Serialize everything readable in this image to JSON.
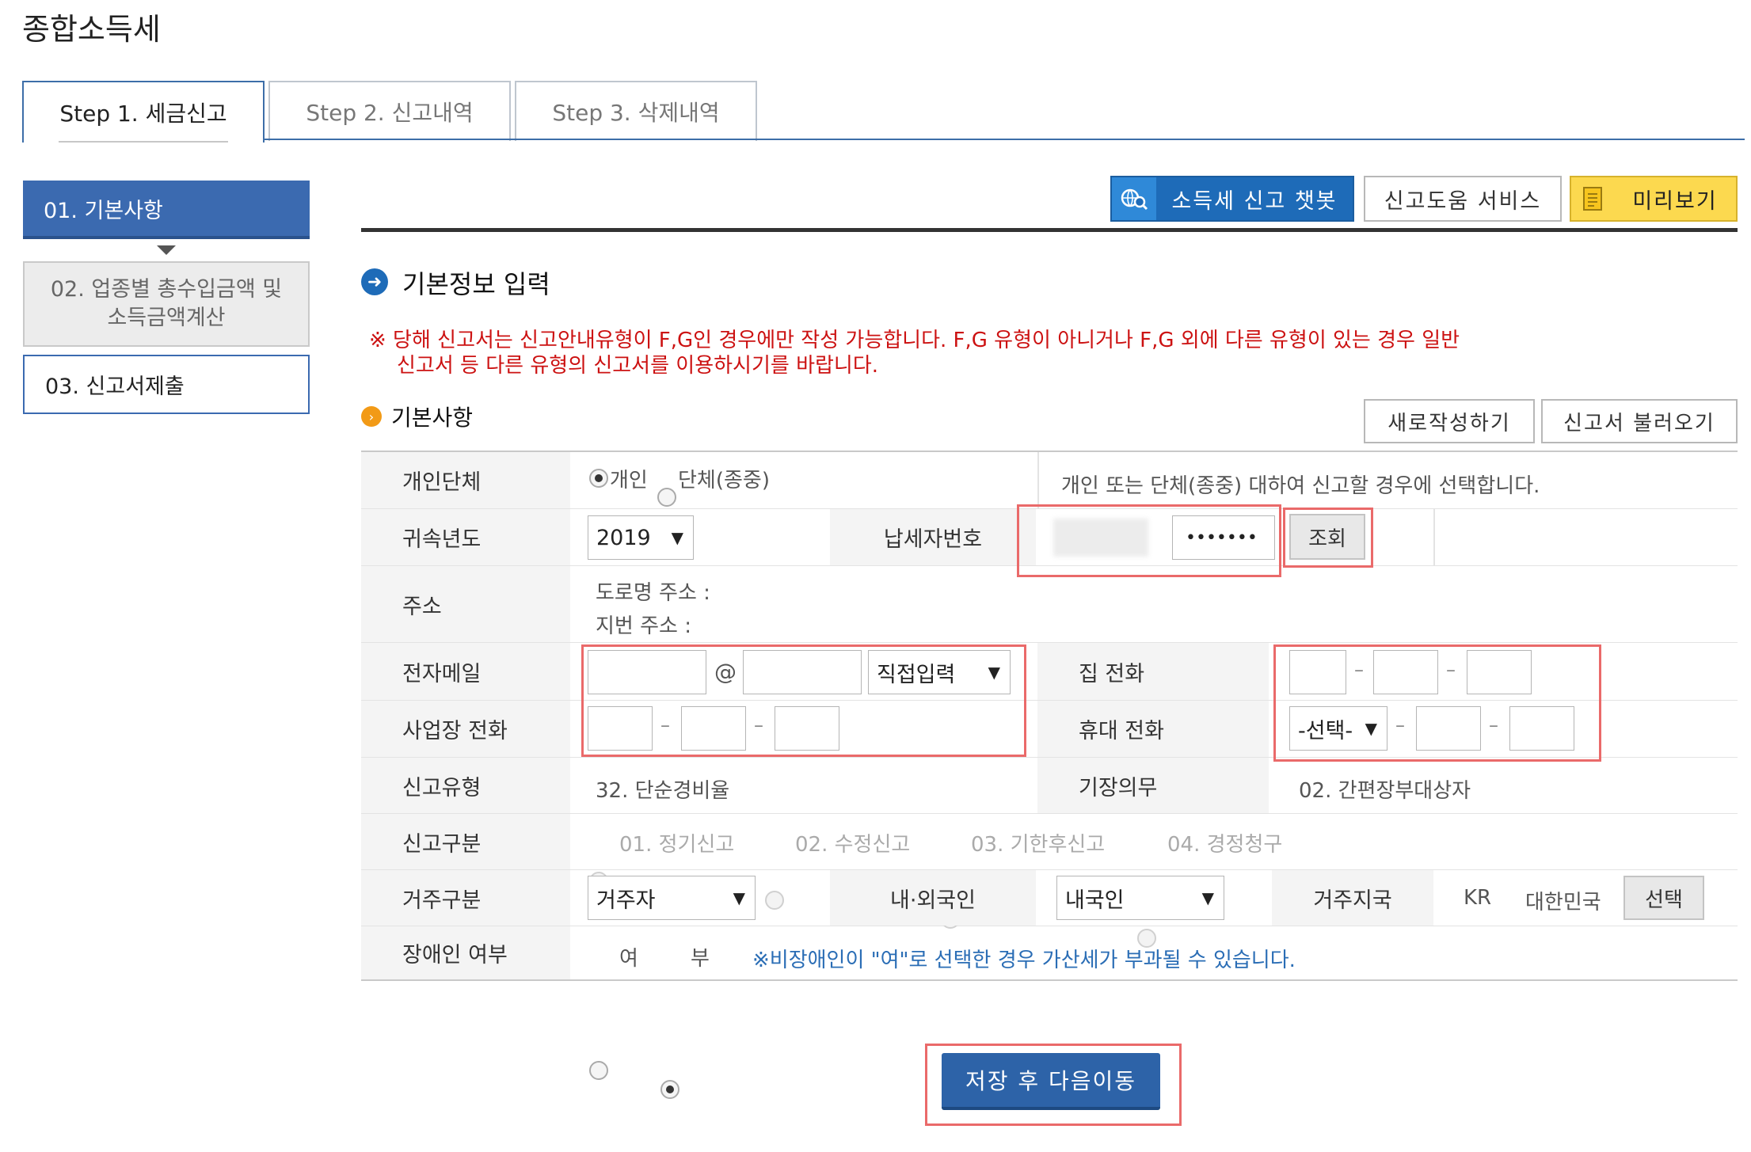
{
  "page_title": "종합소득세",
  "tabs": [
    {
      "label": "Step 1. 세금신고"
    },
    {
      "label": "Step 2. 신고내역"
    },
    {
      "label": "Step 3. 삭제내역"
    }
  ],
  "steps": [
    {
      "label": "01. 기본사항"
    },
    {
      "label_line1": "02. 업종별 총수입금액 및",
      "label_line2": "소득금액계산"
    },
    {
      "label": "03. 신고서제출"
    }
  ],
  "toolbar": {
    "chatbot": "소득세 신고 챗봇",
    "help": "신고도움 서비스",
    "preview": "미리보기"
  },
  "section": {
    "title": "기본정보 입력",
    "notice_line1": "※ 당해 신고서는 신고안내유형이 F,G인 경우에만 작성 가능합니다. F,G 유형이 아니거나 F,G 외에 다른 유형이 있는 경우 일반",
    "notice_line2": "신고서 등 다른 유형의 신고서를 이용하시기를 바랍니다.",
    "sub_title": "기본사항",
    "new_button": "새로작성하기",
    "load_button": "신고서 불러오기"
  },
  "form": {
    "entity": {
      "label": "개인단체",
      "option_individual": "개인",
      "option_group": "단체(종중)",
      "selected": "개인",
      "help": "개인 또는 단체(종중) 대하여 신고할 경우에 선택합니다."
    },
    "year": {
      "label": "귀속년도",
      "value": "2019"
    },
    "taxpayer_no": {
      "label": "납세자번호",
      "masked_value": "•••••••",
      "lookup_button": "조회"
    },
    "address": {
      "label": "주소",
      "road": "도로명 주소 :",
      "lot": "지번 주소 :"
    },
    "email": {
      "label": "전자메일",
      "at": "@",
      "domain_select": "직접입력"
    },
    "home_phone": {
      "label": "집 전화"
    },
    "work_phone": {
      "label": "사업장 전화"
    },
    "mobile_phone": {
      "label": "휴대 전화",
      "prefix_select": "-선택-"
    },
    "report_type": {
      "label": "신고유형",
      "value": "32. 단순경비율"
    },
    "bookkeeping": {
      "label": "기장의무",
      "value": "02. 간편장부대상자"
    },
    "report_class": {
      "label": "신고구분",
      "options": [
        "01. 정기신고",
        "02. 수정신고",
        "03. 기한후신고",
        "04. 경정청구"
      ],
      "selected": "01. 정기신고"
    },
    "residence": {
      "label": "거주구분",
      "value": "거주자",
      "nationality_label": "내·외국인",
      "nationality_value": "내국인",
      "country_label": "거주지국",
      "country_code": "KR",
      "country_name": "대한민국",
      "select_button": "선택"
    },
    "disability": {
      "label": "장애인 여부",
      "yes": "여",
      "no": "부",
      "selected": "부",
      "note": "※비장애인이 \"여\"로 선택한 경우 가산세가 부과될 수 있습니다."
    }
  },
  "save_button": "저장 후 다음이동",
  "colors": {
    "primary": "#2d63a8",
    "notice": "#cc1111",
    "highlight": "#ea6a6a",
    "preview": "#fcd94f"
  }
}
